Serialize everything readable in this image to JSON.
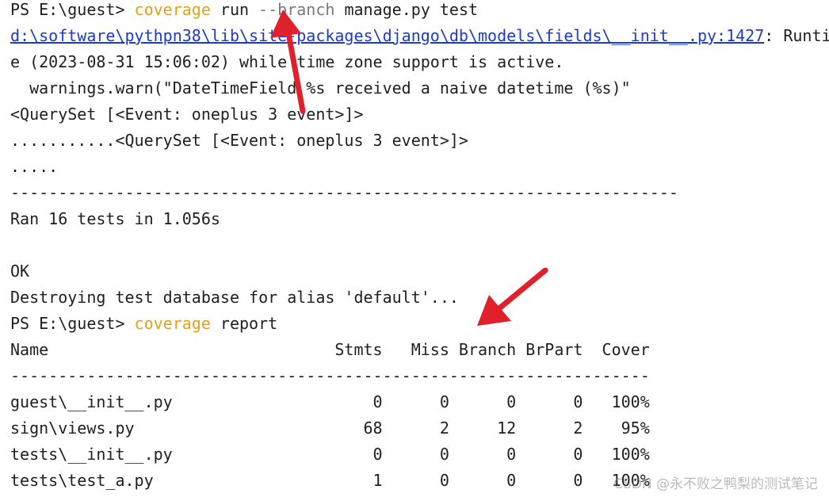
{
  "terminal": {
    "prompt1": "PS E:\\guest> ",
    "cmd1_keyword": "coverage",
    "cmd1_run": " run ",
    "cmd1_param": "--branch",
    "cmd1_rest": " manage.py test",
    "warning_link": "d:\\software\\pythpn38\\lib\\site-packages\\django\\db\\models\\fields\\__init__.py:1427",
    "warning_tail": ": Runtim",
    "warning_line2": "e (2023-08-31 15:06:02) while time zone support is active.",
    "warning_line3": "  warnings.warn(\"DateTimeField %s received a naive datetime (%s)\"",
    "queryset1": "<QuerySet [<Event: oneplus 3 event>]>",
    "dots_queryset": "...........<QuerySet [<Event: oneplus 3 event>]>",
    "dots": ".....",
    "separator": "----------------------------------------------------------------------",
    "ran": "Ran 16 tests in 1.056s",
    "ok": "OK",
    "destroying": "Destroying test database for alias 'default'...",
    "prompt2": "PS E:\\guest> ",
    "cmd2_keyword": "coverage",
    "cmd2_rest": " report"
  },
  "report": {
    "header": "Name                              Stmts   Miss Branch BrPart  Cover",
    "separator": "-------------------------------------------------------------------",
    "rows": [
      "guest\\__init__.py                     0      0      0      0   100%",
      "sign\\views.py                        68      2     12      2    95%",
      "tests\\__init__.py                     0      0      0      0   100%",
      "tests\\test_a.py                       1      0      0      0   100%"
    ]
  },
  "annotations": {
    "arrow_color": "#e0202a"
  },
  "watermark": "CSDN @永不败之鸭梨的测试笔记"
}
